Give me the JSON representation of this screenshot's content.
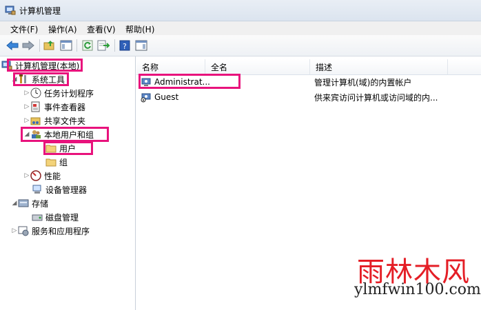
{
  "window": {
    "title": "计算机管理"
  },
  "menu": [
    "文件(F)",
    "操作(A)",
    "查看(V)",
    "帮助(H)"
  ],
  "toolbar": {
    "buttons": [
      "back-arrow-icon",
      "forward-arrow-icon",
      "up-folder-icon",
      "show-hide-console-tree-icon",
      "refresh-icon",
      "export-list-icon",
      "help-icon",
      "show-hide-action-pane-icon"
    ]
  },
  "tree": {
    "root": "计算机管理(本地)",
    "system_tools": "系统工具",
    "task_scheduler": "任务计划程序",
    "event_viewer": "事件查看器",
    "shared_folders": "共享文件夹",
    "local_users_groups": "本地用户和组",
    "users": "用户",
    "groups": "组",
    "performance": "性能",
    "device_manager": "设备管理器",
    "storage": "存储",
    "disk_management": "磁盘管理",
    "services_apps": "服务和应用程序"
  },
  "list": {
    "columns": [
      "名称",
      "全名",
      "描述"
    ],
    "rows": [
      {
        "name": "Administrat...",
        "fullname": "",
        "description": "管理计算机(域)的内置帐户"
      },
      {
        "name": "Guest",
        "fullname": "",
        "description": "供来宾访问计算机或访问域的内..."
      }
    ]
  },
  "watermark": {
    "logo": "雨林木风",
    "url": "ylmfwin100.com"
  },
  "colors": {
    "highlight": "#e8127c",
    "watermark_red": "#e41e26"
  }
}
